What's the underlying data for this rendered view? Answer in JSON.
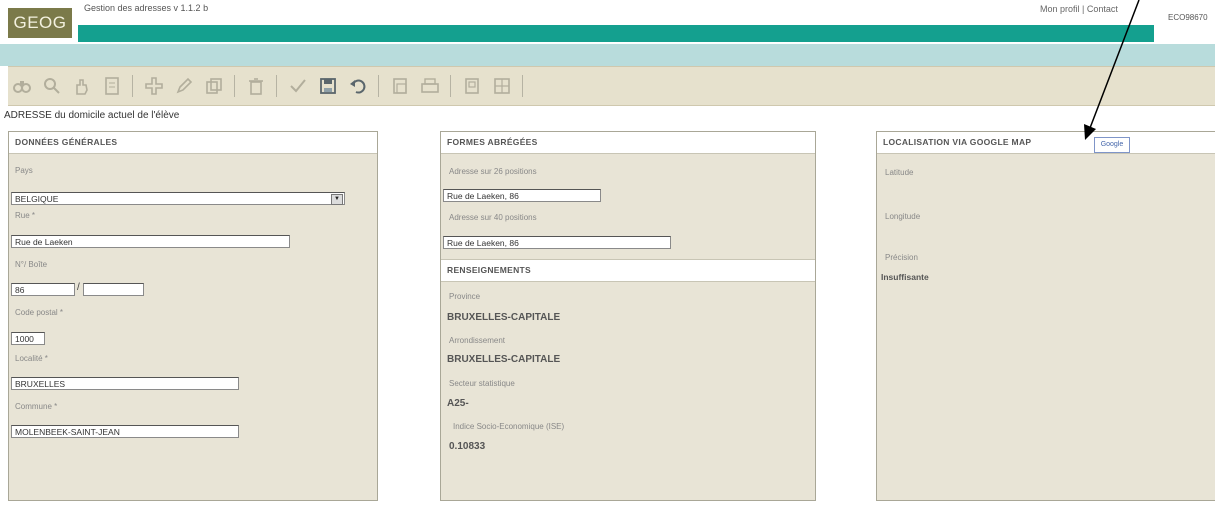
{
  "header": {
    "logo": "GEOG",
    "app_title": "Gestion des adresses v 1.1.2 b",
    "top_links": "Mon profil | Contact",
    "user_id": "ECO98670"
  },
  "toolbar": {
    "icons": [
      "binoculars-icon",
      "search-icon",
      "hand-icon",
      "document-icon",
      "add-icon",
      "edit-icon",
      "copy-icon",
      "delete-icon",
      "check-icon",
      "save-icon",
      "undo-icon",
      "page-icon",
      "print-icon",
      "notes-icon",
      "grid-icon"
    ]
  },
  "page_heading": "ADRESSE du domicile actuel de l'élève",
  "general": {
    "title": "DONNÉES GÉNÉRALES",
    "pays_label": "Pays",
    "pays_value": "BELGIQUE",
    "rue_label": "Rue *",
    "rue_value": "Rue de Laeken",
    "numero_label": "N°/ Boîte",
    "numero_value": "86",
    "boite_value": "",
    "cp_label": "Code postal *",
    "cp_value": "1000",
    "localite_label": "Localité *",
    "localite_value": "BRUXELLES",
    "commune_label": "Commune *",
    "commune_value": "MOLENBEEK-SAINT-JEAN"
  },
  "short": {
    "title": "FORMES ABRÉGÉES",
    "addr26_label": "Adresse sur 26 positions",
    "addr26_value": "Rue de Laeken, 86",
    "addr40_label": "Adresse sur 40 positions",
    "addr40_value": "Rue de Laeken, 86"
  },
  "info": {
    "title": "RENSEIGNEMENTS",
    "province_label": "Province",
    "province_value": "BRUXELLES-CAPITALE",
    "arr_label": "Arrondissement",
    "arr_value": "BRUXELLES-CAPITALE",
    "secteur_label": "Secteur statistique",
    "secteur_value": "A25-",
    "ise_label": "Indice Socio-Economique (ISE)",
    "ise_value": "0.10833"
  },
  "location": {
    "title": "LOCALISATION VIA GOOGLE MAP",
    "google_button": "Google",
    "latitude_label": "Latitude",
    "longitude_label": "Longitude",
    "precision_label": "Précision",
    "precision_value": "Insuffisante"
  },
  "colors": {
    "teal": "#14a08f",
    "light_teal": "#b8dcdc",
    "panel": "#e8e4d6",
    "logo": "#7b7a4a"
  }
}
